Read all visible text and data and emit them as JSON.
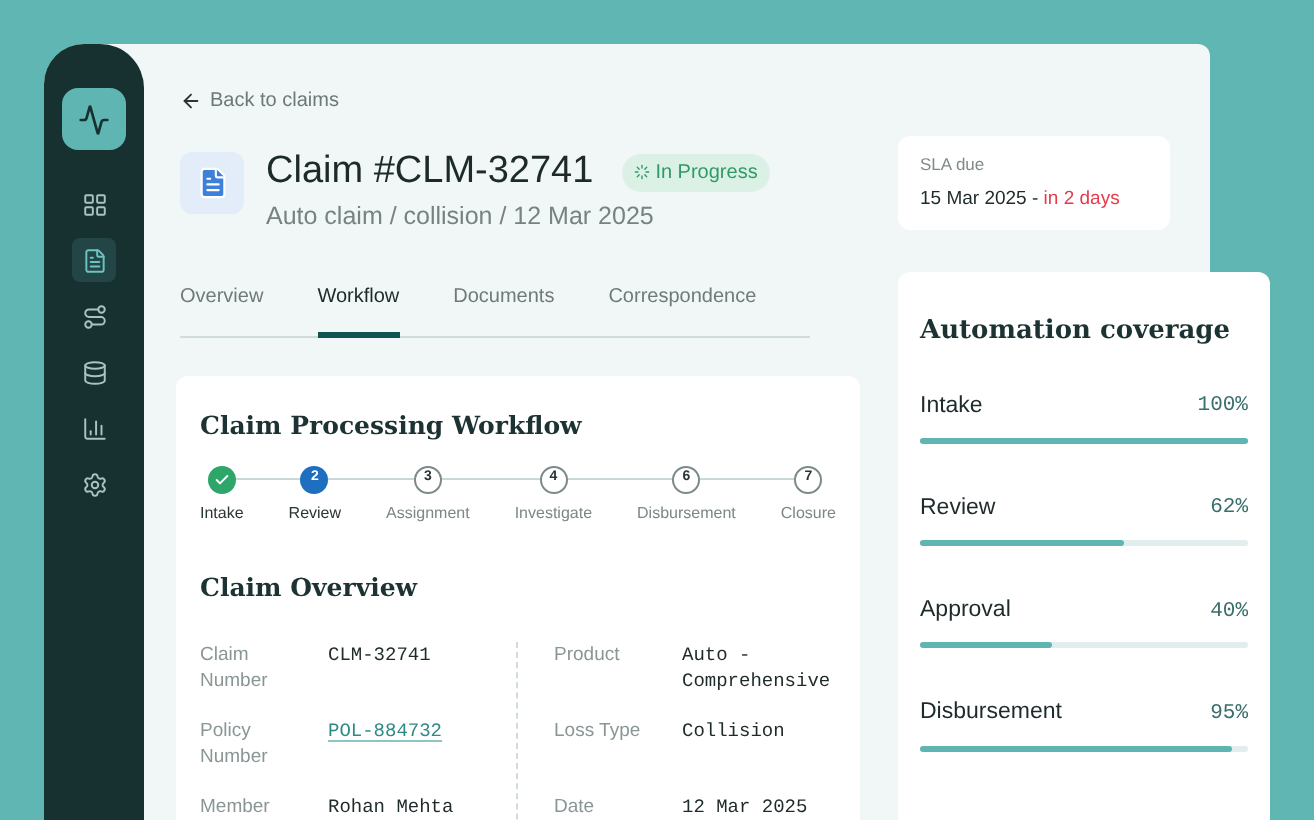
{
  "sidebar": {
    "items": [
      {
        "selected": false
      },
      {
        "selected": true
      },
      {
        "selected": false
      },
      {
        "selected": false
      },
      {
        "selected": false
      },
      {
        "selected": false
      }
    ]
  },
  "back_link": "Back to claims",
  "header": {
    "title": "Claim #CLM-32741",
    "status": "In Progress",
    "subtitle": "Auto claim / collision / 12 Mar 2025"
  },
  "sla": {
    "label": "SLA due",
    "date": "15 Mar 2025 - ",
    "remaining": "in 2 days"
  },
  "tabs": [
    {
      "label": "Overview",
      "selected": false
    },
    {
      "label": "Workflow",
      "selected": true
    },
    {
      "label": "Documents",
      "selected": false
    },
    {
      "label": "Correspondence",
      "selected": false
    }
  ],
  "workflow": {
    "title": "Claim Processing Workflow",
    "steps": [
      {
        "label": "Intake",
        "kind": "done"
      },
      {
        "label": "Review",
        "number": "2",
        "kind": "current"
      },
      {
        "label": "Assignment",
        "number": "3",
        "kind": "upcoming"
      },
      {
        "label": "Investigate",
        "number": "4",
        "kind": "upcoming"
      },
      {
        "label": "Disbursement",
        "number": "6",
        "kind": "upcoming"
      },
      {
        "label": "Closure",
        "number": "7",
        "kind": "upcoming"
      }
    ]
  },
  "overview": {
    "title": "Claim Overview",
    "left": [
      {
        "label": "Claim Number",
        "value": "CLM-32741",
        "link": false
      },
      {
        "label": "Policy Number",
        "value": "POL-884732",
        "link": true
      },
      {
        "label": "Member",
        "value": "Rohan Mehta",
        "link": false
      }
    ],
    "right": [
      {
        "label": "Product",
        "value": "Auto - Comprehensive",
        "link": false
      },
      {
        "label": "Loss Type",
        "value": "Collision",
        "link": false
      },
      {
        "label": "Date",
        "value": "12 Mar 2025",
        "link": false
      }
    ]
  },
  "coverage": {
    "title": "Automation coverage",
    "items": [
      {
        "label": "Intake",
        "reading": "100%",
        "level": 1.0
      },
      {
        "label": "Review",
        "reading": "62%",
        "level": 0.62
      },
      {
        "label": "Approval",
        "reading": "40%",
        "level": 0.4
      },
      {
        "label": "Disbursement",
        "reading": "95%",
        "level": 0.95
      }
    ]
  }
}
